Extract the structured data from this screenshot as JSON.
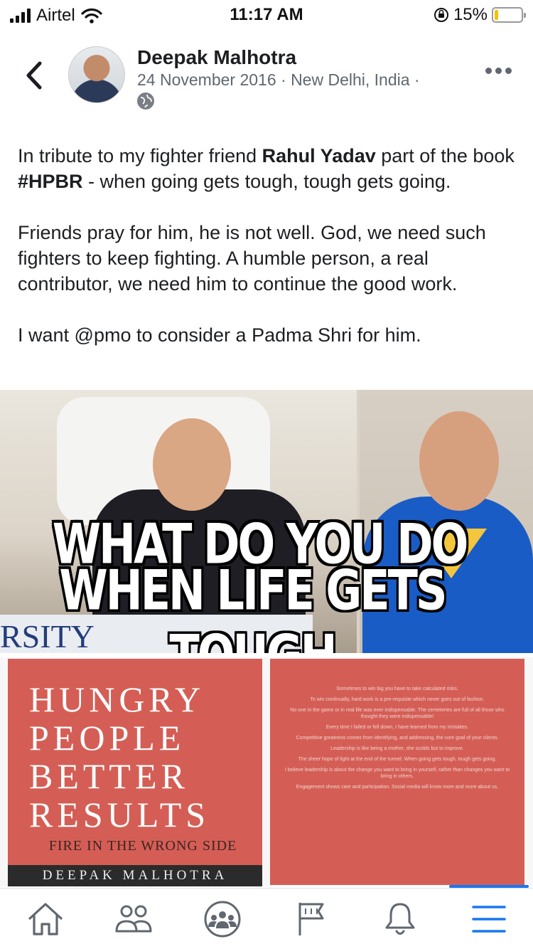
{
  "status_bar": {
    "carrier": "Airtel",
    "time": "11:17 AM",
    "battery_percent": "15%",
    "battery_level": 0.15
  },
  "header": {
    "author": "Deepak Malhotra",
    "meta": "24 November 2016 · New Delhi, India ·",
    "icons": [
      "back-chevron-icon",
      "globe-icon",
      "more-dots-icon"
    ]
  },
  "post": {
    "line1_pre": "In tribute to my fighter friend ",
    "line1_bold": "Rahul Yadav",
    "line1_mid": " part of the book ",
    "line1_tag": "#HPBR",
    "line1_post": " - when going gets tough, tough gets going.",
    "paragraph2": "Friends pray for him, he is not well. God, we need such fighters to keep fighting. A humble person, a real contributor, we need him to continue the good work.",
    "paragraph3": "I want @pmo to consider a Padma Shri for him."
  },
  "photo1": {
    "caption_line1": "WHAT DO YOU DO",
    "caption_line2": "WHEN LIFE GETS TOUGH",
    "fragment_text": "RSITY"
  },
  "photo2": {
    "title_lines": [
      "HUNGRY",
      "PEOPLE",
      "BETTER",
      "RESULTS"
    ],
    "subtitle": "FIRE IN THE WRONG SIDE",
    "author": "DEEPAK MALHOTRA",
    "back_quotes": [
      "Sometimes to win big you have to take calculated risks.",
      "To win continually, hard work is a pre-requisite which never goes out of fashion.",
      "No one in the game or in real life was ever indispensable. The cemeteries are full of all those who thought they were indispensable!",
      "Every time I failed or fell down, I have learned from my mistakes.",
      "Competitive greatness comes from identifying, and addressing, the core goal of your clients.",
      "Leadership is like being a mother, she scolds but to improve.",
      "The sheer hope of light at the end of the tunnel. When going gets tough, tough gets going.",
      "I believe leadership is about the change you want to bring in yourself, rather than changes you want to bring in others.",
      "Engagement shows care and participation. Social media will know more and more about us."
    ]
  },
  "bottom_nav": {
    "items": [
      "home-icon",
      "friends-icon",
      "groups-icon",
      "pages-flag-icon",
      "notifications-bell-icon",
      "menu-icon"
    ],
    "active": "menu-icon",
    "accent": "#1877f2"
  }
}
